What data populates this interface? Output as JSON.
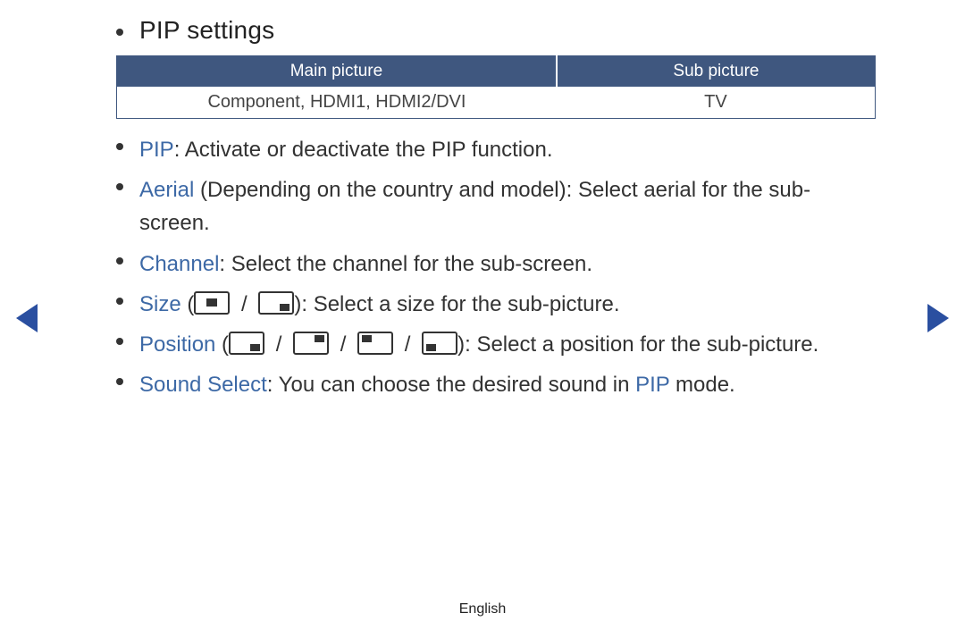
{
  "heading": "PIP settings",
  "table": {
    "header_main": "Main picture",
    "header_sub": "Sub picture",
    "cell_main": "Component, HDMI1, HDMI2/DVI",
    "cell_sub": "TV"
  },
  "items": {
    "pip_key": "PIP",
    "pip_desc": ": Activate or deactivate the PIP function.",
    "aerial_key": "Aerial",
    "aerial_desc": " (Depending on the country and model): Select aerial for the sub-screen.",
    "channel_key": "Channel",
    "channel_desc": ": Select the channel for the sub-screen.",
    "size_key": "Size",
    "size_open": " (",
    "size_sep": " / ",
    "size_close": "): Select a size for the sub-picture.",
    "position_key": "Position",
    "position_open": " (",
    "position_sep": " / ",
    "position_close": "): Select a position for the sub-picture.",
    "sound_key": "Sound Select",
    "sound_pre": ": You can choose the desired sound in ",
    "sound_mid": "PIP",
    "sound_post": " mode."
  },
  "footer": "English"
}
